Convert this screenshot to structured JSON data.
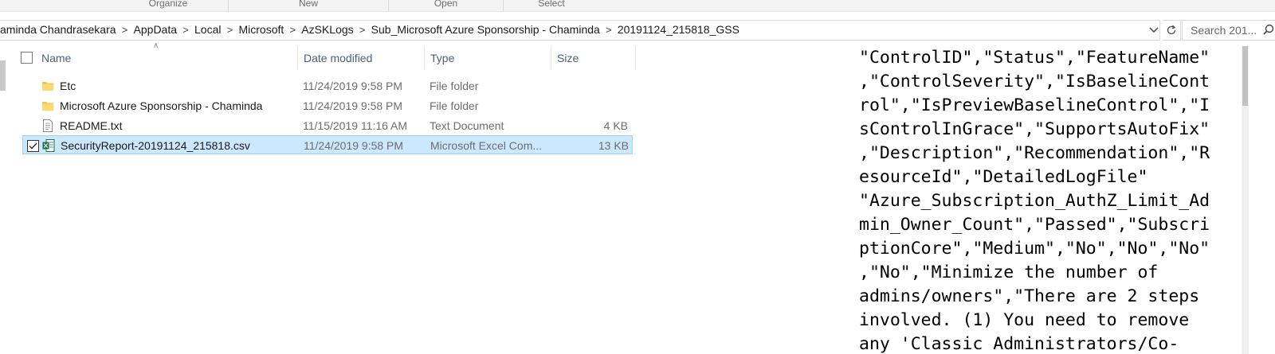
{
  "ribbon": {
    "groups": [
      "Organize",
      "New",
      "Open",
      "Select"
    ]
  },
  "address": {
    "crumbs": [
      "aminda Chandrasekara",
      "AppData",
      "Local",
      "Microsoft",
      "AzSKLogs",
      "Sub_Microsoft Azure Sponsorship - Chaminda",
      "20191124_215818_GSS"
    ],
    "search_placeholder": "Search 201..."
  },
  "columns": {
    "name": "Name",
    "date": "Date modified",
    "type": "Type",
    "size": "Size"
  },
  "files": [
    {
      "name": "Etc",
      "date": "11/24/2019 9:58 PM",
      "type": "File folder",
      "size": "",
      "icon": "folder-icon"
    },
    {
      "name": "Microsoft Azure Sponsorship - Chaminda",
      "date": "11/24/2019 9:58 PM",
      "type": "File folder",
      "size": "",
      "icon": "folder-icon"
    },
    {
      "name": "README.txt",
      "date": "11/15/2019 11:16 AM",
      "type": "Text Document",
      "size": "4 KB",
      "icon": "text-file-icon"
    },
    {
      "name": "SecurityReport-20191124_215818.csv",
      "date": "11/24/2019 9:58 PM",
      "type": "Microsoft Excel Com...",
      "size": "13 KB",
      "icon": "excel-file-icon",
      "selected": true
    }
  ],
  "preview": {
    "lines": [
      "\"ControlID\",\"Status\",\"FeatureName\"",
      ",\"ControlSeverity\",\"IsBaselineCont",
      "rol\",\"IsPreviewBaselineControl\",\"I",
      "sControlInGrace\",\"SupportsAutoFix\"",
      ",\"Description\",\"Recommendation\",\"R",
      "esourceId\",\"DetailedLogFile\"",
      "\"Azure_Subscription_AuthZ_Limit_Ad",
      "min_Owner_Count\",\"Passed\",\"Subscri",
      "ptionCore\",\"Medium\",\"No\",\"No\",\"No\"",
      ",\"No\",\"Minimize the number of",
      "admins/owners\",\"There are 2 steps",
      "involved. (1) You need to remove",
      "any 'Classic Administrators/Co-"
    ]
  },
  "colors": {
    "selection_bg": "#cce8ff",
    "selection_border": "#99d1ff",
    "header_text": "#4c607a",
    "folder": "#f2c14e",
    "excel": "#1e7145"
  }
}
